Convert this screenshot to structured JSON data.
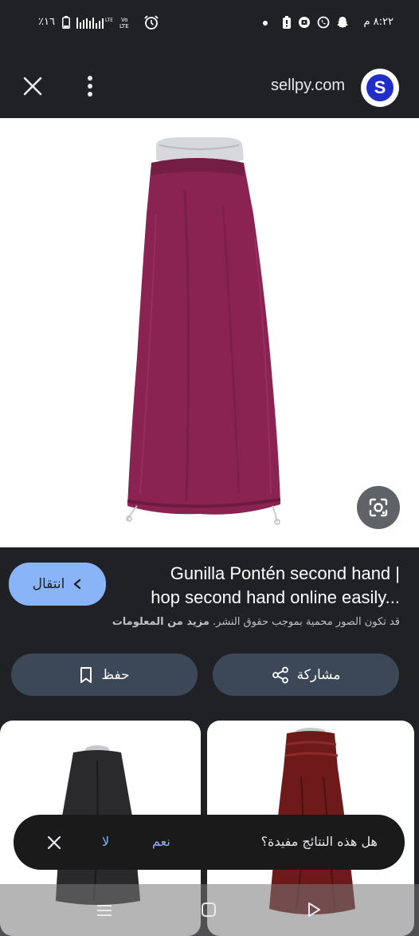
{
  "status_bar": {
    "time": "٨:٢٢ م",
    "battery": "٪١٦",
    "network": "LTE",
    "volte": "Vo LTE"
  },
  "header": {
    "close_icon": "close-icon",
    "menu_icon": "more-vert-icon",
    "site_name": "sellpy.com",
    "logo_letter": "S",
    "brand_color": "#1f2ec8"
  },
  "image": {
    "skirt_color": "#8a2352",
    "lens_icon": "google-lens-icon"
  },
  "result": {
    "title_line1": "Gunilla Pontén second hand |",
    "title_line2": "hop second hand online easily...",
    "visit_label": "انتقال",
    "copyright_text": "قد تكون الصور محمية بموجب حقوق النشر.",
    "more_info": "مزيد من المعلومات"
  },
  "actions": {
    "share_label": "مشاركة",
    "save_label": "حفظ"
  },
  "feedback": {
    "question": "هل هذه النتائج مفيدة؟",
    "yes": "نعم",
    "no": "لا"
  },
  "colors": {
    "background": "#202124",
    "accent": "#8ab4f8",
    "pill": "#3c4758"
  }
}
